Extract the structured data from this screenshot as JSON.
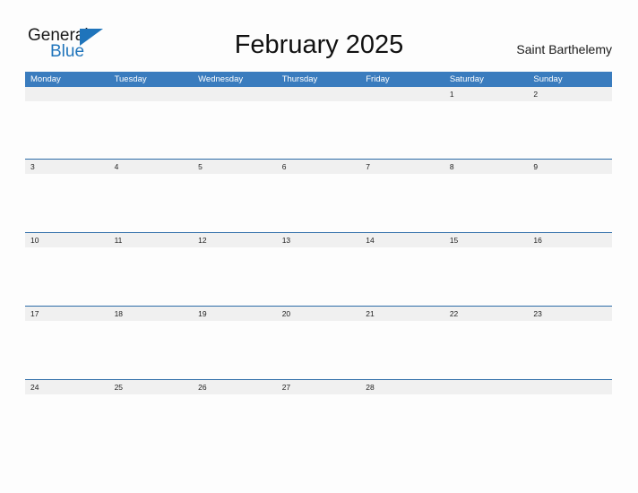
{
  "brand": {
    "name_top": "General",
    "name_bottom": "Blue",
    "accent_color": "#1f74bb"
  },
  "header": {
    "title": "February 2025",
    "location": "Saint Barthelemy"
  },
  "calendar": {
    "header_bg": "#3a7cbe",
    "date_band_bg": "#f0f0f0",
    "separator_color": "#2d6ca8",
    "weekdays": [
      "Monday",
      "Tuesday",
      "Wednesday",
      "Thursday",
      "Friday",
      "Saturday",
      "Sunday"
    ],
    "weeks": [
      [
        "",
        "",
        "",
        "",
        "",
        "1",
        "2"
      ],
      [
        "3",
        "4",
        "5",
        "6",
        "7",
        "8",
        "9"
      ],
      [
        "10",
        "11",
        "12",
        "13",
        "14",
        "15",
        "16"
      ],
      [
        "17",
        "18",
        "19",
        "20",
        "21",
        "22",
        "23"
      ],
      [
        "24",
        "25",
        "26",
        "27",
        "28",
        "",
        ""
      ]
    ]
  }
}
